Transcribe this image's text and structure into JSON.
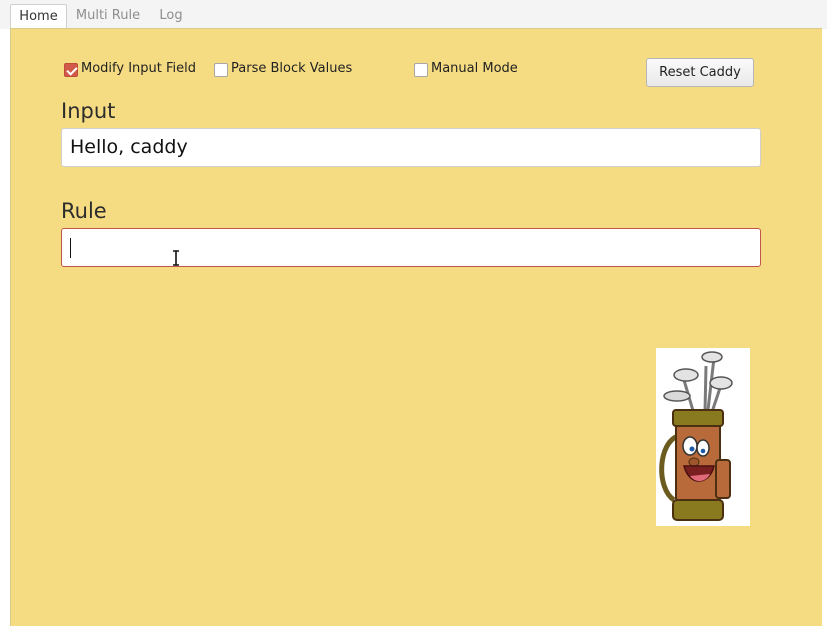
{
  "tabs": [
    "Home",
    "Multi Rule",
    "Log"
  ],
  "options": {
    "modify_input_field": {
      "label": "Modify Input Field",
      "checked": true
    },
    "parse_block_values": {
      "label": "Parse Block Values",
      "checked": false
    },
    "manual_mode": {
      "label": "Manual Mode",
      "checked": false
    }
  },
  "reset_button": "Reset Caddy",
  "input": {
    "label": "Input",
    "value": "Hello, caddy"
  },
  "rule": {
    "label": "Rule",
    "value": ""
  },
  "colors": {
    "panel": "#f5dc82",
    "accent": "#d15a4a"
  }
}
